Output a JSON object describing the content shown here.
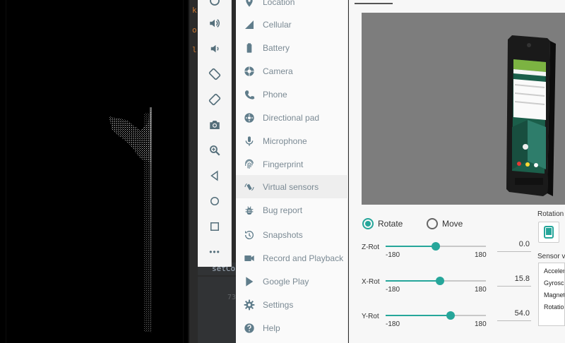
{
  "code": {
    "lines": [
      "k",
      "o",
      "l"
    ],
    "bottom_text": "setCon",
    "line_number": "73"
  },
  "toolbar": {
    "items": [
      {
        "icon": "power-icon"
      },
      {
        "icon": "volume-up-icon"
      },
      {
        "icon": "volume-down-icon"
      },
      {
        "icon": "rotate-left-icon"
      },
      {
        "icon": "rotate-right-icon"
      },
      {
        "icon": "camera-icon"
      },
      {
        "icon": "zoom-in-icon"
      },
      {
        "icon": "back-icon"
      },
      {
        "icon": "home-icon"
      },
      {
        "icon": "overview-icon"
      },
      {
        "icon": "more-icon",
        "glyph": "•••"
      }
    ]
  },
  "nav": {
    "items": [
      {
        "label": "Location",
        "icon": "location-pin-icon"
      },
      {
        "label": "Cellular",
        "icon": "signal-icon"
      },
      {
        "label": "Battery",
        "icon": "battery-icon"
      },
      {
        "label": "Camera",
        "icon": "camera-aperture-icon"
      },
      {
        "label": "Phone",
        "icon": "phone-icon"
      },
      {
        "label": "Directional pad",
        "icon": "dpad-icon"
      },
      {
        "label": "Microphone",
        "icon": "microphone-icon"
      },
      {
        "label": "Fingerprint",
        "icon": "fingerprint-icon"
      },
      {
        "label": "Virtual sensors",
        "icon": "rotation-sensor-icon",
        "active": true
      },
      {
        "label": "Bug report",
        "icon": "bug-icon"
      },
      {
        "label": "Snapshots",
        "icon": "history-icon"
      },
      {
        "label": "Record and Playback",
        "icon": "video-icon"
      },
      {
        "label": "Google Play",
        "icon": "play-icon"
      },
      {
        "label": "Settings",
        "icon": "gear-icon"
      },
      {
        "label": "Help",
        "icon": "help-icon"
      }
    ]
  },
  "sensors": {
    "mode": {
      "rotate_label": "Rotate",
      "move_label": "Move",
      "selected": "Rotate"
    },
    "sliders": [
      {
        "name": "Z-Rot",
        "min": "-180",
        "max": "180",
        "value": "0.0",
        "level": 0.5
      },
      {
        "name": "X-Rot",
        "min": "-180",
        "max": "180",
        "value": "15.8",
        "level": 0.544
      },
      {
        "name": "Y-Rot",
        "min": "-180",
        "max": "180",
        "value": "54.0",
        "level": 0.65
      }
    ],
    "rotation_label": "Rotation",
    "sensor_values_label": "Sensor va",
    "sensor_list": [
      "Acceler",
      "Gyrosc",
      "Magnet",
      "Rotatio"
    ]
  },
  "colors": {
    "accent": "#26a69a",
    "nav_text": "#7b8a94",
    "nav_icon": "#607d8b",
    "preview_bg": "#7d7d7d"
  }
}
